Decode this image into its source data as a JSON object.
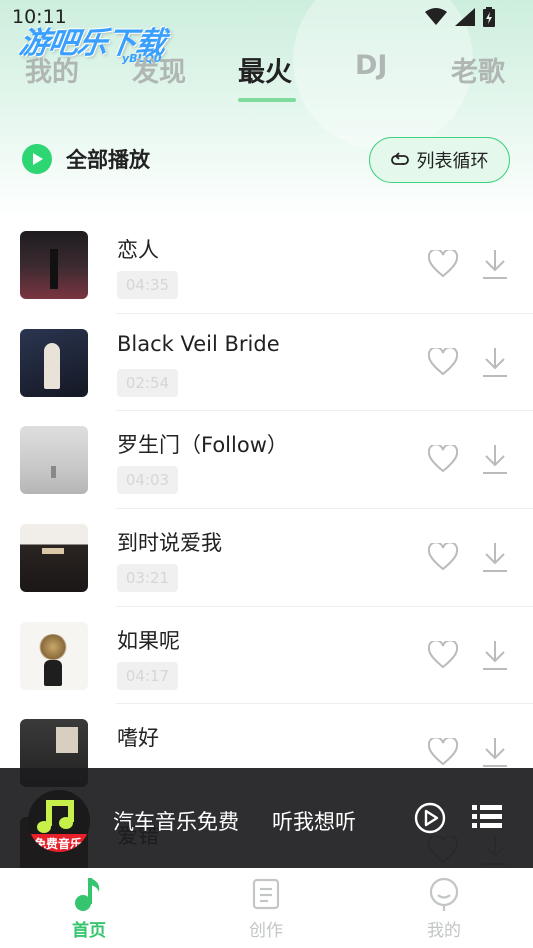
{
  "status_bar": {
    "time": "10:11",
    "icons": [
      "wifi-icon",
      "signal-icon",
      "battery-icon"
    ]
  },
  "watermark": {
    "main": "游吧乐下载",
    "sub": "yBLQ0"
  },
  "tabs": [
    {
      "label": "我的",
      "active": false
    },
    {
      "label": "发现",
      "active": false
    },
    {
      "label": "最火",
      "active": true
    },
    {
      "label": "DJ",
      "active": false
    },
    {
      "label": "老歌",
      "active": false
    }
  ],
  "controls": {
    "play_all": "全部播放",
    "loop_mode": "列表循环"
  },
  "songs": [
    {
      "title": "恋人",
      "duration": "04:35"
    },
    {
      "title": "Black Veil Bride",
      "duration": "02:54"
    },
    {
      "title": "罗生门（Follow）",
      "duration": "04:03"
    },
    {
      "title": "到时说爱我",
      "duration": "03:21"
    },
    {
      "title": "如果呢",
      "duration": "04:17"
    },
    {
      "title": "嗜好",
      "duration": ""
    },
    {
      "title": "爱错",
      "duration": ""
    }
  ],
  "mini_player": {
    "app_name": "汽车音乐免费",
    "song": "听我想听",
    "cover_label": "免费音乐"
  },
  "bottom_nav": [
    {
      "label": "首页",
      "active": true
    },
    {
      "label": "创作",
      "active": false
    },
    {
      "label": "我的",
      "active": false
    }
  ],
  "colors": {
    "accent": "#2ed573",
    "tab_indicator": "#7fdc9c",
    "inactive_text": "#b0b6b3"
  }
}
